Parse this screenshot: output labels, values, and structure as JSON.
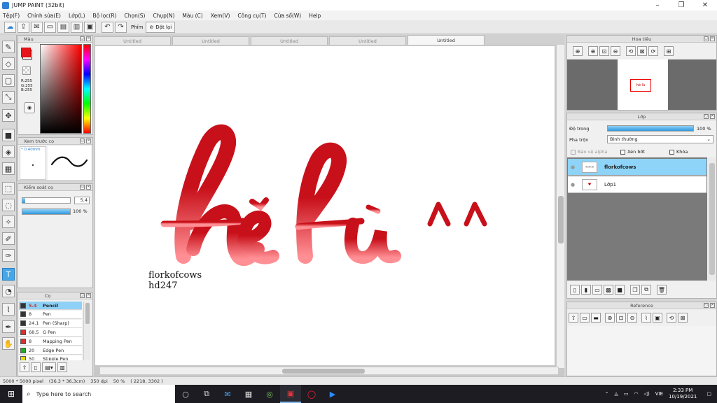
{
  "window": {
    "title": "JUMP PAINT (32bit)",
    "minimize": "–",
    "maximize": "❐",
    "close": "✕"
  },
  "menu": [
    "Tệp(F)",
    "Chỉnh sửa(E)",
    "Lớp(L)",
    "Bộ lọc(R)",
    "Chọn(S)",
    "Chụp(N)",
    "Màu (C)",
    "Xem(V)",
    "Công cụ(T)",
    "Cửa sổ(W)",
    "Help"
  ],
  "toolbar": {
    "shortcut_label": "Phím",
    "reset_label": "Đặt lại"
  },
  "tabs": [
    {
      "label": "Untitled",
      "active": false
    },
    {
      "label": "Untitled",
      "active": false
    },
    {
      "label": "Untitled",
      "active": false
    },
    {
      "label": "Untitled",
      "active": false
    },
    {
      "label": "Untitled",
      "active": true
    }
  ],
  "color_panel": {
    "title": "Màu",
    "r": "R:255",
    "g": "G:255",
    "b": "B:255",
    "primary": "#e8141c"
  },
  "preview_panel": {
    "title": "Xem trước cọ",
    "size": "0.40mm"
  },
  "control_panel": {
    "title": "Kiểm soát cọ",
    "size_value": "5.4",
    "opacity_value": "100 %",
    "opacity_fraction": 1.0
  },
  "brush_panel": {
    "title": "Cọ",
    "brushes": [
      {
        "size": "5.4",
        "name": "Pencil",
        "color": "#333333",
        "selected": true
      },
      {
        "size": "8",
        "name": "Pen",
        "color": "#333333",
        "selected": false
      },
      {
        "size": "24.1",
        "name": "Pen (Sharp)",
        "color": "#333333",
        "selected": false
      },
      {
        "size": "68.5",
        "name": "G Pen",
        "color": "#d63031",
        "selected": false
      },
      {
        "size": "8",
        "name": "Mapping Pen",
        "color": "#d63031",
        "selected": false
      },
      {
        "size": "20",
        "name": "Edge Pen",
        "color": "#22aa22",
        "selected": false
      },
      {
        "size": "50",
        "name": "Stipple Pen",
        "color": "#dddd00",
        "selected": false
      }
    ]
  },
  "canvas": {
    "signature_line1": "florkofcows",
    "signature_line2": "hd247",
    "art_color_top": "#c8101a",
    "art_color_bottom": "#ff8f94"
  },
  "navigator_panel": {
    "title": "Hoa tiêu"
  },
  "layer_panel": {
    "title": "Lớp",
    "opacity_label": "Độ trong",
    "opacity_value": "100 %",
    "opacity_fraction": 1.0,
    "blend_label": "Pha trộn",
    "blend_value": "Bình thường",
    "protect_alpha": "Bảo vệ alpha",
    "clipping": "Xén bớt",
    "lock": "Khóa",
    "layers": [
      {
        "name": "florkofcows",
        "selected": true
      },
      {
        "name": "Lớp1",
        "selected": false
      }
    ]
  },
  "reference_panel": {
    "title": "Reference"
  },
  "status": {
    "size": "5000 * 5000 pixel",
    "physical": "(36.3 * 36.3cm)",
    "dpi": "350 dpi",
    "zoom": "50 %",
    "coords": "( 2218, 3302 )"
  },
  "taskbar": {
    "search_placeholder": "Type here to search",
    "language": "VIE",
    "time": "2:33 PM",
    "date": "10/19/2021"
  }
}
